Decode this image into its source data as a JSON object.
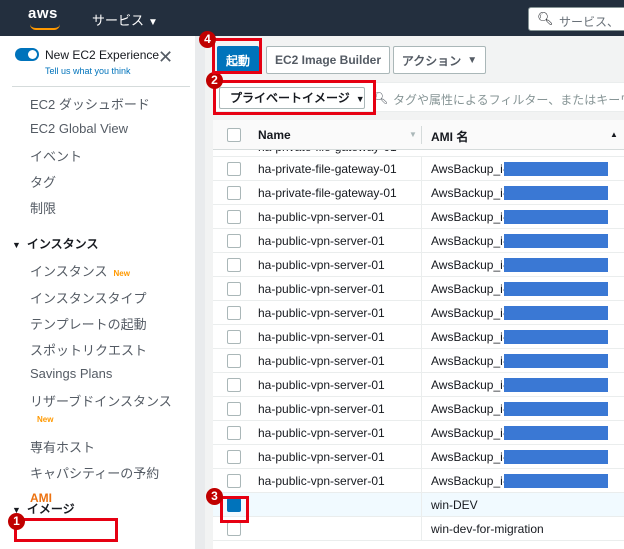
{
  "topbar": {
    "logo": "aws",
    "services_label": "サービス",
    "search_placeholder": "サービス、"
  },
  "sidebar": {
    "experience_title": "New EC2 Experience",
    "experience_link": "Tell us what you think",
    "items_top": [
      "EC2 ダッシュボード",
      "EC2 Global View",
      "イベント",
      "タグ",
      "制限"
    ],
    "section_instances": "インスタンス",
    "instances_items": [
      "インスタンス",
      "インスタンスタイプ",
      "テンプレートの起動",
      "スポットリクエスト",
      "Savings Plans",
      "リザーブドインスタンス",
      "専有ホスト",
      "キャパシティーの予約"
    ],
    "new_badge": "New",
    "section_images": "イメージ",
    "ami_label": "AMI"
  },
  "toolbar": {
    "launch_label": "起動",
    "builder_label": "EC2 Image Builder",
    "action_label": "アクション"
  },
  "filter": {
    "scope_label": "プライベートイメージ",
    "search_placeholder": "タグや属性によるフィルター、またはキーワー"
  },
  "table": {
    "col_name": "Name",
    "col_ami": "AMI 名",
    "partial_top": "ha-private-file-gateway-01",
    "rows": [
      {
        "name": "ha-private-file-gateway-01",
        "ami": "AwsBackup_i-",
        "masked": true,
        "selected": false
      },
      {
        "name": "ha-private-file-gateway-01",
        "ami": "AwsBackup_i-",
        "masked": true,
        "selected": false
      },
      {
        "name": "ha-public-vpn-server-01",
        "ami": "AwsBackup_i-",
        "masked": true,
        "selected": false
      },
      {
        "name": "ha-public-vpn-server-01",
        "ami": "AwsBackup_i-",
        "masked": true,
        "selected": false
      },
      {
        "name": "ha-public-vpn-server-01",
        "ami": "AwsBackup_i-",
        "masked": true,
        "selected": false
      },
      {
        "name": "ha-public-vpn-server-01",
        "ami": "AwsBackup_i-",
        "masked": true,
        "selected": false
      },
      {
        "name": "ha-public-vpn-server-01",
        "ami": "AwsBackup_i-",
        "masked": true,
        "selected": false
      },
      {
        "name": "ha-public-vpn-server-01",
        "ami": "AwsBackup_i-",
        "masked": true,
        "selected": false
      },
      {
        "name": "ha-public-vpn-server-01",
        "ami": "AwsBackup_i-",
        "masked": true,
        "selected": false
      },
      {
        "name": "ha-public-vpn-server-01",
        "ami": "AwsBackup_i-",
        "masked": true,
        "selected": false
      },
      {
        "name": "ha-public-vpn-server-01",
        "ami": "AwsBackup_i-",
        "masked": true,
        "selected": false
      },
      {
        "name": "ha-public-vpn-server-01",
        "ami": "AwsBackup_i-",
        "masked": true,
        "selected": false
      },
      {
        "name": "ha-public-vpn-server-01",
        "ami": "AwsBackup_i-",
        "masked": true,
        "selected": false
      },
      {
        "name": "ha-public-vpn-server-01",
        "ami": "AwsBackup_i-",
        "masked": true,
        "selected": false
      },
      {
        "name": "",
        "ami": "win-DEV",
        "masked": false,
        "selected": true
      },
      {
        "name": "",
        "ami": "win-dev-for-migration",
        "masked": false,
        "selected": false
      }
    ]
  },
  "annotations": {
    "step1": "1",
    "step2": "2",
    "step3": "3",
    "step4": "4",
    "color": "#e60012"
  }
}
